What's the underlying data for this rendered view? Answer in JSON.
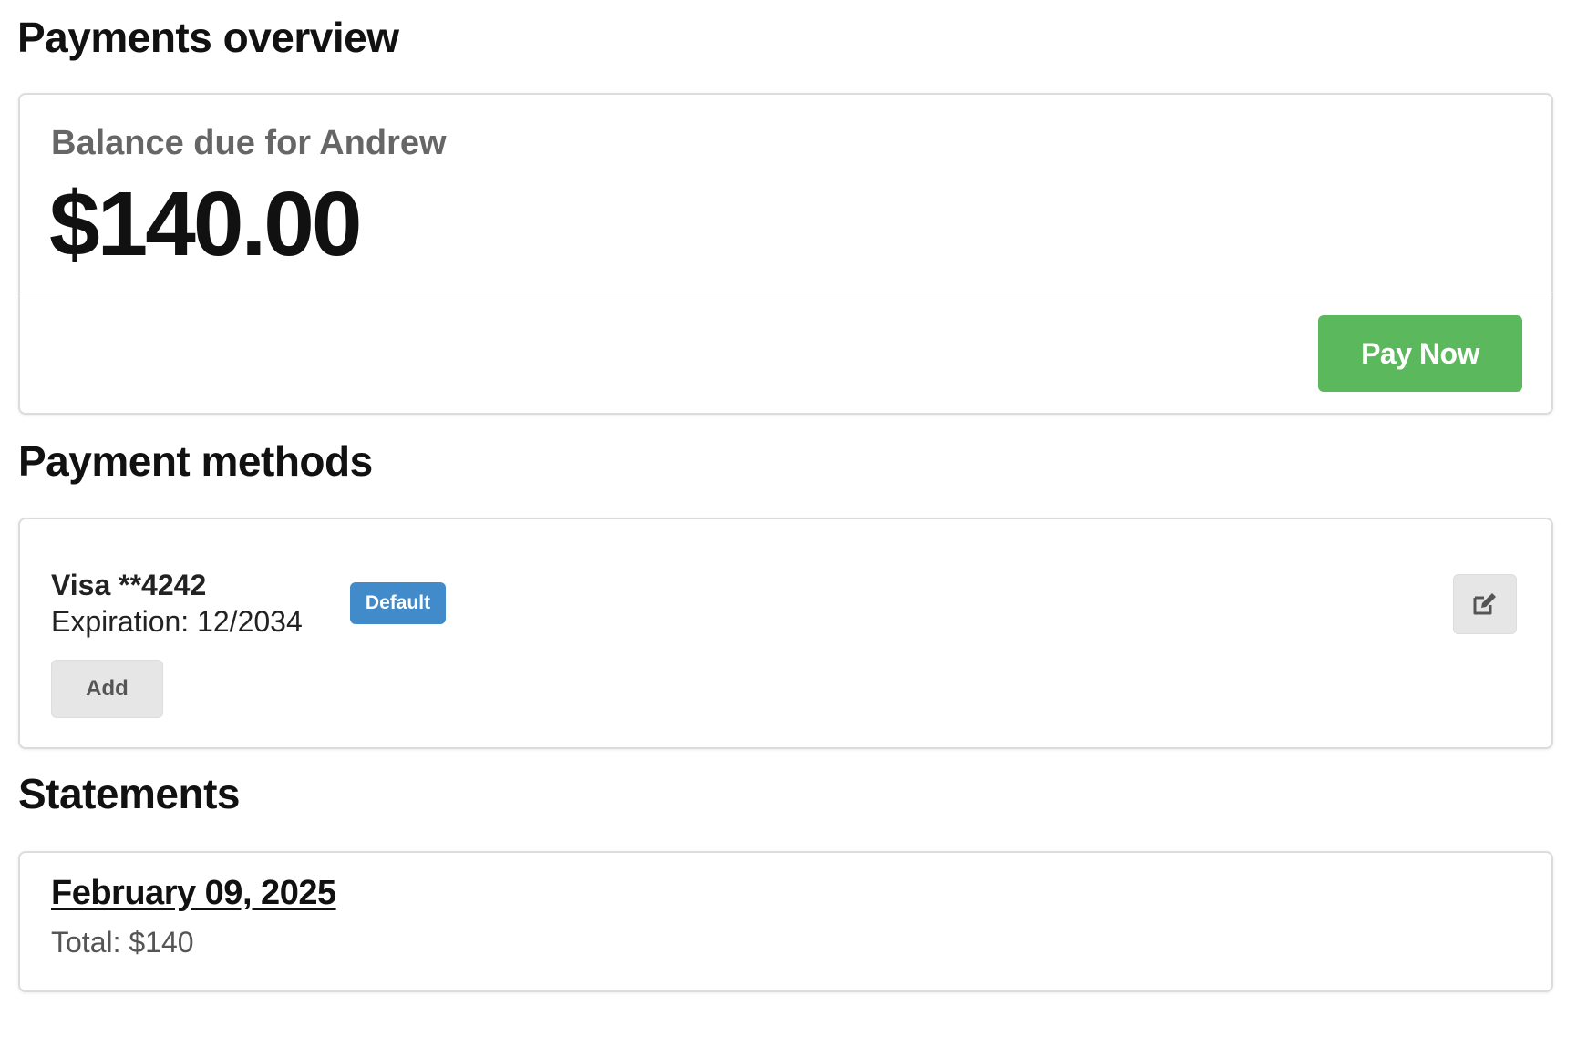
{
  "overview": {
    "title": "Payments overview",
    "balance_label": "Balance due for Andrew",
    "balance_amount": "$140.00",
    "pay_button_label": "Pay Now"
  },
  "payment_methods": {
    "title": "Payment methods",
    "cards": [
      {
        "name": "Visa **4242",
        "expiration": "Expiration: 12/2034",
        "badge": "Default",
        "edit_icon": "edit-icon"
      }
    ],
    "add_button_label": "Add"
  },
  "statements": {
    "title": "Statements",
    "items": [
      {
        "date": "February 09, 2025",
        "total": "Total: $140"
      }
    ]
  },
  "colors": {
    "pay_button": "#5cb85c",
    "default_badge": "#428bca",
    "secondary_button": "#e6e6e6",
    "muted_text": "#666666"
  }
}
